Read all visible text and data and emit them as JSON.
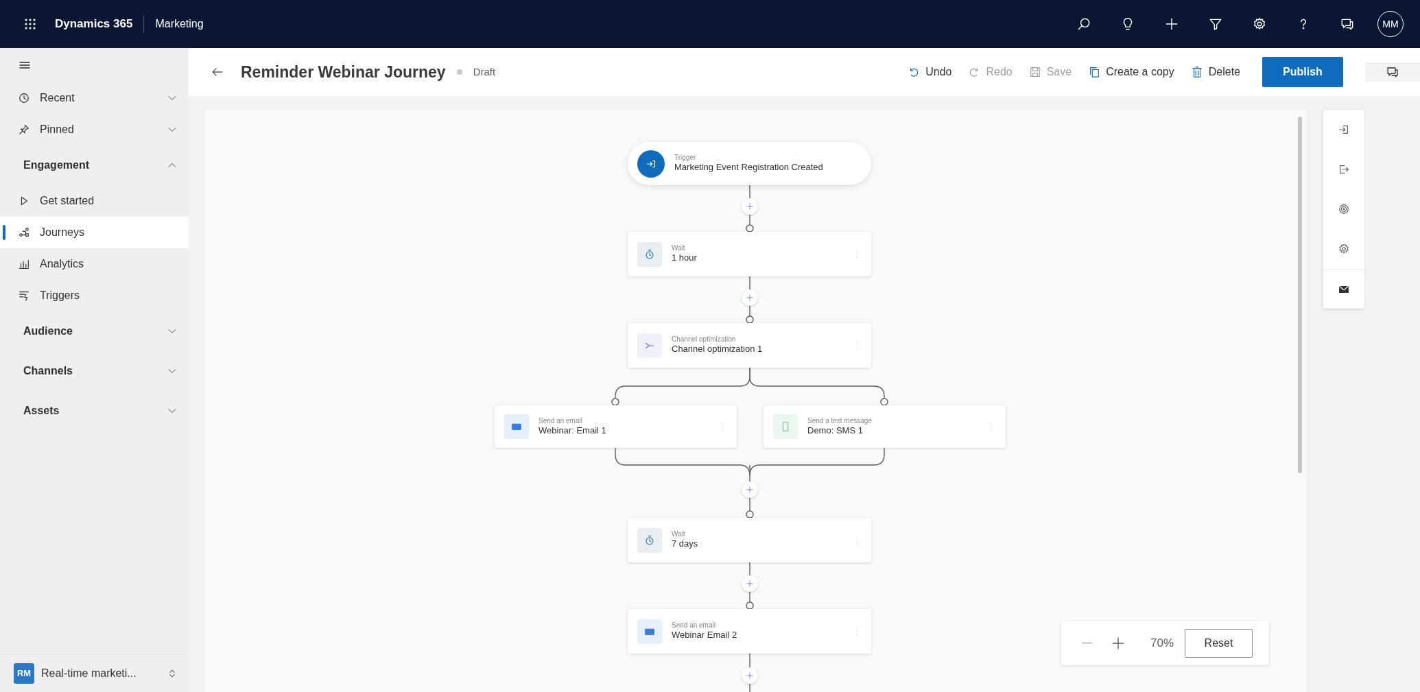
{
  "top_bar": {
    "app_name": "Dynamics 365",
    "module": "Marketing",
    "avatar": "MM"
  },
  "sidebar": {
    "items": [
      {
        "kind": "flyout",
        "label": "Recent",
        "expanded": false,
        "selected": false
      },
      {
        "kind": "flyout",
        "label": "Pinned",
        "expanded": false,
        "selected": false
      },
      {
        "kind": "group",
        "label": "Engagement",
        "expanded": true,
        "selected": false,
        "children": [
          {
            "label": "Get started",
            "selected": false
          },
          {
            "label": "Journeys",
            "selected": true
          },
          {
            "label": "Analytics",
            "selected": false
          },
          {
            "label": "Triggers",
            "selected": false
          }
        ]
      },
      {
        "kind": "group",
        "label": "Audience",
        "expanded": false,
        "selected": false
      },
      {
        "kind": "group",
        "label": "Channels",
        "expanded": false,
        "selected": false
      },
      {
        "kind": "group",
        "label": "Assets",
        "expanded": false,
        "selected": false
      }
    ],
    "area": {
      "badge": "RM",
      "label": "Real-time marketi..."
    }
  },
  "header": {
    "title": "Reminder Webinar Journey",
    "status": "Draft",
    "commands": [
      {
        "kind": "undo",
        "label": "Undo",
        "disabled": false
      },
      {
        "kind": "redo",
        "label": "Redo",
        "disabled": true
      },
      {
        "kind": "save",
        "label": "Save",
        "disabled": true
      },
      {
        "kind": "copy",
        "label": "Create a copy",
        "disabled": false
      },
      {
        "kind": "delete",
        "label": "Delete",
        "disabled": false
      }
    ],
    "publish": "Publish"
  },
  "journey": {
    "steps": [
      {
        "kind": "trigger",
        "type_label": "Trigger",
        "title": "Marketing Event Registration Created"
      },
      {
        "kind": "wait",
        "type_label": "Wait",
        "title": "1 hour"
      },
      {
        "kind": "channel_optimization",
        "type_label": "Channel optimization",
        "title": "Channel optimization 1",
        "branches": [
          {
            "kind": "email",
            "type_label": "Send an email",
            "title": "Webinar: Email 1"
          },
          {
            "kind": "sms",
            "type_label": "Send a text message",
            "title": "Demo: SMS 1"
          }
        ]
      },
      {
        "kind": "wait",
        "type_label": "Wait",
        "title": "7 days"
      },
      {
        "kind": "email",
        "type_label": "Send an email",
        "title": "Webinar Email 2"
      }
    ]
  },
  "zoom": {
    "level_text": "70%",
    "reset": "Reset"
  }
}
